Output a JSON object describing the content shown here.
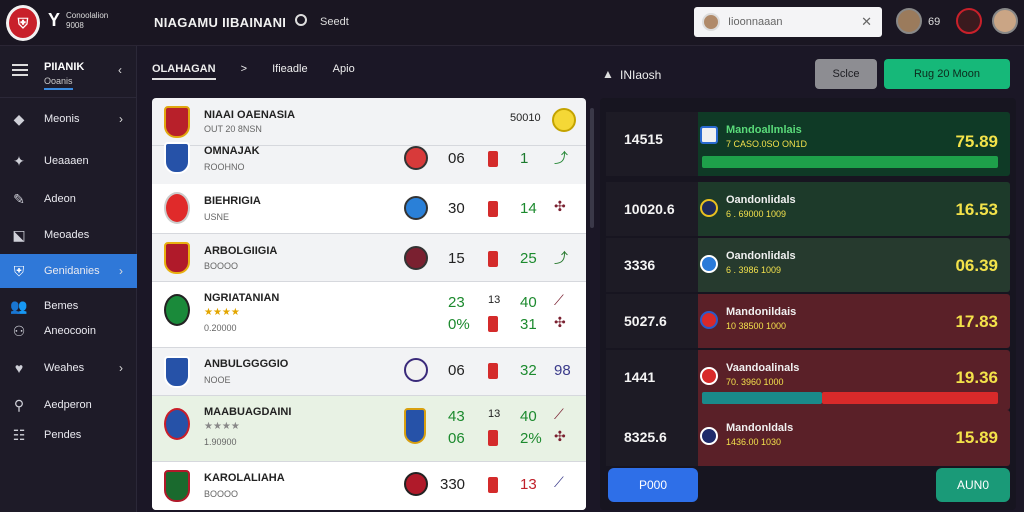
{
  "header": {
    "brand": "Y",
    "brand_sub_1": "Conoolalion",
    "brand_sub_2": "9008",
    "title": "NIAGAMU IIBAINANI",
    "link": "Seedt",
    "search_value": "Iioonnaaan",
    "count": "69"
  },
  "sidebar": {
    "head_title": "PIIANIK",
    "head_sub": "Ooanis",
    "items": [
      {
        "label": "Meonis",
        "icon": "cube-icon"
      },
      {
        "label": "Ueaaaen",
        "icon": "shield-icon"
      },
      {
        "label": "Adeon",
        "icon": "edit-icon"
      },
      {
        "label": "Meoades",
        "icon": "arrow-icon"
      },
      {
        "label": "Genidanies",
        "icon": "team-icon"
      },
      {
        "label": "Bemes",
        "icon": "users-icon"
      },
      {
        "label": "Aneocooin",
        "icon": "users-icon"
      },
      {
        "label": "Weahes",
        "icon": "heart-icon"
      },
      {
        "label": "Aedperon",
        "icon": "search-icon"
      },
      {
        "label": "Pendes",
        "icon": "list-icon"
      }
    ]
  },
  "breadcrumb": {
    "first": "OLAHAGAN",
    "sep": ">",
    "second": "Ifieadle",
    "third": "Apio"
  },
  "matches": [
    {
      "name": "NIAAI OAENASIA",
      "sub": "OUT 20 8NSN",
      "score_a": "",
      "score_b": "",
      "green": "50010",
      "extra": "50010"
    },
    {
      "name": "OMNAJAK",
      "sub": "ROOHNO",
      "score_a": "06",
      "green": "1"
    },
    {
      "name": "BIEHRIGIA",
      "sub": "USNE",
      "score_a": "30",
      "green": "14"
    },
    {
      "name": "ARBOLGIIGIA",
      "sub": "BOOOO",
      "score_a": "15",
      "green": "25"
    },
    {
      "name": "NGRIATANIAN",
      "sub": "0.20000",
      "stars": "★★★★",
      "score_a": "23",
      "score_b": "0%",
      "mid": "13",
      "green": "40",
      "green2": "31"
    },
    {
      "name": "ANBULGGGGIO",
      "sub": "NOOE",
      "score_a": "06",
      "green": "32",
      "green2": "98"
    },
    {
      "name": "MAABUAGDAINI",
      "sub": "1.90900",
      "stars": "★★★★",
      "score_a": "43",
      "score_b": "06",
      "mid": "13",
      "green": "40",
      "green2": "2%"
    },
    {
      "name": "KAROLALIAHA",
      "sub": "BOOOO",
      "score_a": "330",
      "green": "13"
    }
  ],
  "right_panel": {
    "title": "INIaosh",
    "grey_button": "Sclce",
    "green_button": "Rug 20 Moon",
    "rows": [
      {
        "left": "14515",
        "name": "Mandoallmlais",
        "sub": "7 CASO.0SO ON1D",
        "value": "75.89",
        "bar": "green"
      },
      {
        "left": "10020.6",
        "name": "Oandonlidals",
        "sub": "6 . 69000 1009",
        "value": "16.53"
      },
      {
        "left": "3336",
        "name": "Oandonlidals",
        "sub": "6 . 3986 1009",
        "value": "06.39"
      },
      {
        "left": "5027.6",
        "name": "Mandonildais",
        "sub": "10 38500 1000",
        "value": "17.83"
      },
      {
        "left": "1441",
        "name": "Vaandoalinals",
        "sub": "70. 3960 1000",
        "value": "19.36",
        "bar": "red"
      },
      {
        "left": "8325.6",
        "name": "Mandonldals",
        "sub": "1436.00 1030",
        "value": "15.89"
      }
    ],
    "blue_button": "P000",
    "teal_button": "AUN0"
  }
}
